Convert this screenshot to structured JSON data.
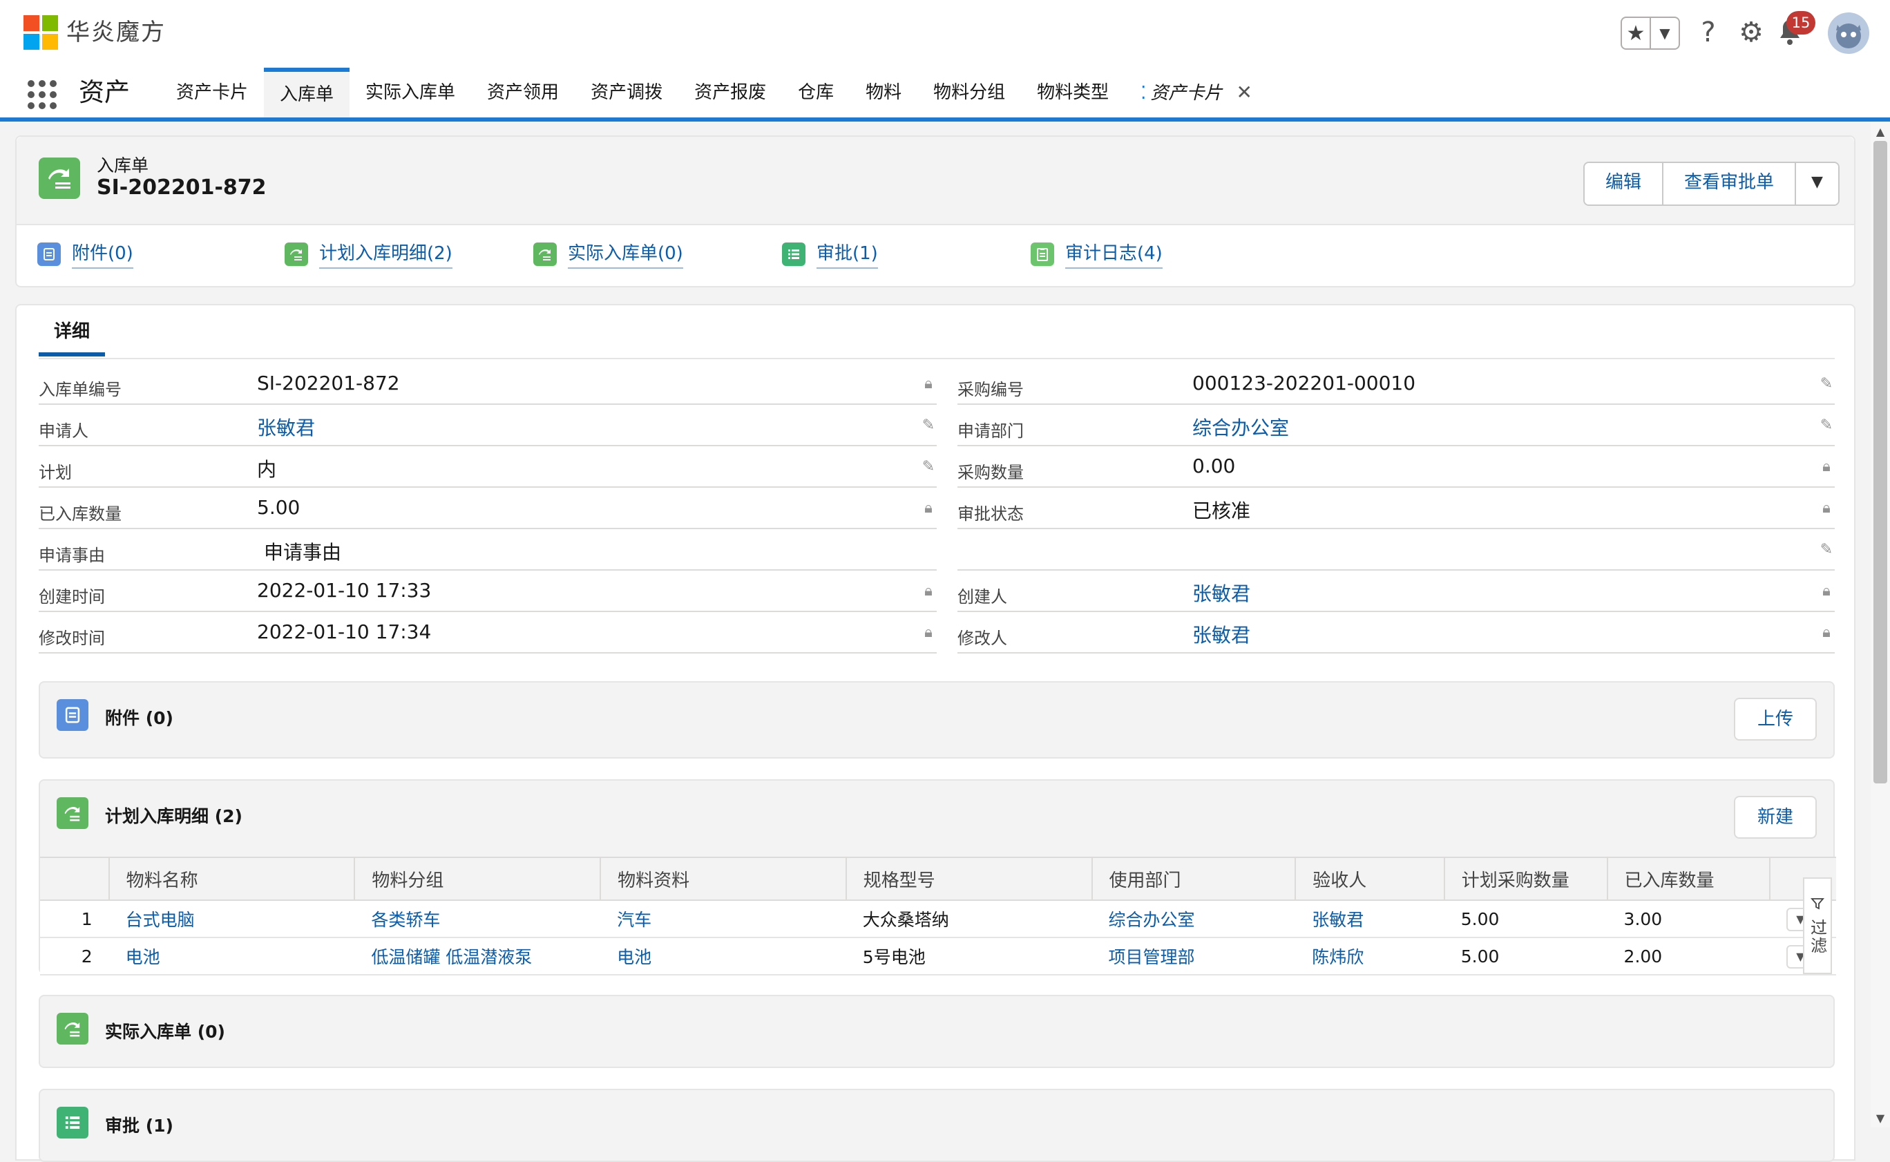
{
  "app": {
    "brand": "华炎魔方",
    "name": "资产"
  },
  "header": {
    "notification_count": "15"
  },
  "nav": {
    "items": [
      {
        "label": "资产卡片"
      },
      {
        "label": "入库单",
        "active": true
      },
      {
        "label": "实际入库单"
      },
      {
        "label": "资产领用"
      },
      {
        "label": "资产调拨"
      },
      {
        "label": "资产报废"
      },
      {
        "label": "仓库"
      },
      {
        "label": "物料"
      },
      {
        "label": "物料分组"
      },
      {
        "label": "物料类型"
      }
    ],
    "open_tab": "资产卡片"
  },
  "record": {
    "object_type": "入库单",
    "title": "SI-202201-872",
    "actions": {
      "edit": "编辑",
      "view_approval": "查看审批单"
    },
    "quick_links": [
      "附件(0)",
      "计划入库明细(2)",
      "实际入库单(0)",
      "审批(1)",
      "审计日志(4)"
    ]
  },
  "detail": {
    "tab_label": "详细",
    "fields": {
      "doc_no": {
        "label": "入库单编号",
        "value": "SI-202201-872"
      },
      "purchase_no": {
        "label": "采购编号",
        "value": "000123-202201-00010"
      },
      "applicant": {
        "label": "申请人",
        "value": "张敏君"
      },
      "department": {
        "label": "申请部门",
        "value": "综合办公室"
      },
      "plan": {
        "label": "计划",
        "value": "内"
      },
      "purchase_qty": {
        "label": "采购数量",
        "value": "0.00"
      },
      "stocked_qty": {
        "label": "已入库数量",
        "value": "5.00"
      },
      "approval": {
        "label": "审批状态",
        "value": "已核准"
      },
      "reason": {
        "label": "申请事由",
        "value": "申请事由"
      },
      "created_at": {
        "label": "创建时间",
        "value": "2022-01-10 17:33"
      },
      "creator": {
        "label": "创建人",
        "value": "张敏君"
      },
      "modified_at": {
        "label": "修改时间",
        "value": "2022-01-10 17:34"
      },
      "modifier": {
        "label": "修改人",
        "value": "张敏君"
      }
    }
  },
  "related": {
    "attachments": {
      "title": "附件 (0)",
      "button": "上传"
    },
    "plan_items": {
      "title": "计划入库明细 (2)",
      "button": "新建",
      "columns": [
        "物料名称",
        "物料分组",
        "物料资料",
        "规格型号",
        "使用部门",
        "验收人",
        "计划采购数量",
        "已入库数量"
      ],
      "rows": [
        {
          "no": "1",
          "name": "台式电脑",
          "group": "各类轿车",
          "material": "汽车",
          "spec": "大众桑塔纳",
          "dept": "综合办公室",
          "receiver": "张敏君",
          "plan_qty": "5.00",
          "stocked_qty": "3.00"
        },
        {
          "no": "2",
          "name": "电池",
          "group": "低温储罐 低温潜液泵",
          "material": "电池",
          "spec": "5号电池",
          "dept": "项目管理部",
          "receiver": "陈炜欣",
          "plan_qty": "5.00",
          "stocked_qty": "2.00"
        }
      ],
      "filter_label": "过滤"
    },
    "actual_orders": {
      "title": "实际入库单 (0)"
    },
    "approvals": {
      "title": "审批 (1)"
    }
  },
  "colors": {
    "brand_blue": "#1b7ad4",
    "link": "#0b5cab",
    "green_icon": "#5fb85f",
    "blue_icon": "#5a8fdd",
    "badge_red": "#c23934"
  },
  "icons": [
    "microsoft-logo",
    "star-icon",
    "help-icon",
    "gear-icon",
    "bell-icon",
    "avatar",
    "waffle-icon",
    "lock-icon",
    "pencil-icon",
    "filter-icon"
  ]
}
